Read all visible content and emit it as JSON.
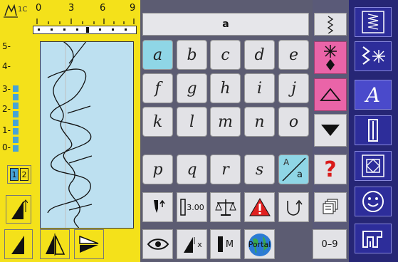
{
  "ruler": {
    "marks": [
      "0",
      "3",
      "6",
      "9"
    ],
    "mode_label": "1C"
  },
  "scale": {
    "labels": [
      "5-",
      "4-",
      "3-",
      "2-",
      "1-",
      "0-"
    ]
  },
  "header": {
    "title": "a"
  },
  "letters": [
    {
      "char": "a",
      "selected": true
    },
    {
      "char": "b"
    },
    {
      "char": "c"
    },
    {
      "char": "d"
    },
    {
      "char": "e"
    },
    {
      "char": "f"
    },
    {
      "char": "g"
    },
    {
      "char": "h"
    },
    {
      "char": "i"
    },
    {
      "char": "j"
    },
    {
      "char": "k"
    },
    {
      "char": "l"
    },
    {
      "char": "m"
    },
    {
      "char": "n"
    },
    {
      "char": "o"
    },
    {
      "char": "p"
    },
    {
      "char": "q"
    },
    {
      "char": "r"
    },
    {
      "char": "s"
    }
  ],
  "case_toggle": {
    "upper": "A",
    "lower": "a"
  },
  "help_label": "?",
  "tools": {
    "stitch_length": "3.00",
    "mem_label": "M",
    "portal_label": "Portal",
    "numbers_label": "0–9",
    "times_label": "x"
  },
  "mirror_split": [
    "1",
    "2"
  ],
  "right_menu": {
    "alpha_label": "A"
  },
  "colors": {
    "accent_yellow": "#f4e11a",
    "pink": "#ea64a8",
    "selected_cyan": "#8fd6e6",
    "sidebar_blue": "#2d2d9a"
  }
}
